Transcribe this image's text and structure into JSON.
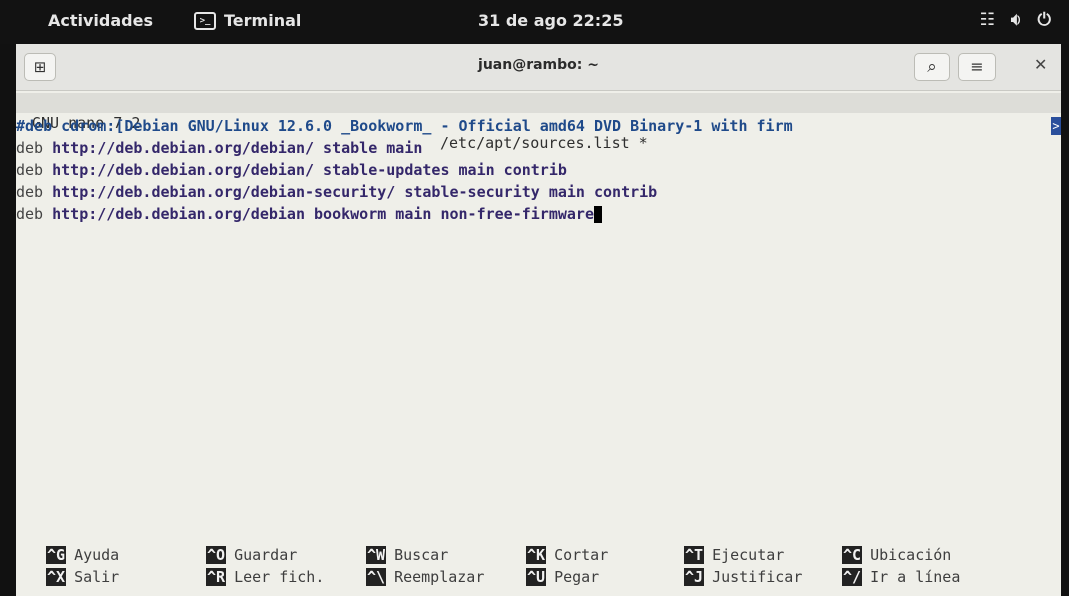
{
  "topbar": {
    "activities": "Actividades",
    "app_name": "Terminal",
    "app_icon": "terminal-icon",
    "clock": "31 de ago  22:25",
    "tray_icons": [
      "network-icon",
      "volume-icon",
      "power-icon"
    ]
  },
  "window": {
    "title": "juan@rambo: ~",
    "new_tab_icon": "new-tab-icon",
    "search_icon": "search-icon",
    "menu_icon": "hamburger-menu-icon",
    "close_icon": "close-icon"
  },
  "nano": {
    "version": "GNU nano 7.2",
    "filename": "/etc/apt/sources.list *",
    "lines": [
      {
        "kw": "#deb",
        "rest": " cdrom:[Debian GNU/Linux 12.6.0 _Bookworm_ - Official amd64 DVD Binary-1 with firm"
      },
      {
        "kw": "deb",
        "rest": " http://deb.debian.org/debian/ stable main"
      },
      {
        "kw": "deb",
        "rest": " http://deb.debian.org/debian/ stable-updates main contrib"
      },
      {
        "kw": "deb",
        "rest": " http://deb.debian.org/debian-security/ stable-security main contrib"
      },
      {
        "kw": "deb",
        "rest": " http://deb.debian.org/debian bookworm main non-free-firmware"
      }
    ],
    "overflow_marker": ">",
    "shortcuts_row1": [
      {
        "key": "^G",
        "label": "Ayuda"
      },
      {
        "key": "^O",
        "label": "Guardar"
      },
      {
        "key": "^W",
        "label": "Buscar"
      },
      {
        "key": "^K",
        "label": "Cortar"
      },
      {
        "key": "^T",
        "label": "Ejecutar"
      },
      {
        "key": "^C",
        "label": "Ubicación"
      }
    ],
    "shortcuts_row2": [
      {
        "key": "^X",
        "label": "Salir"
      },
      {
        "key": "^R",
        "label": "Leer fich."
      },
      {
        "key": "^\\",
        "label": "Reemplazar"
      },
      {
        "key": "^U",
        "label": "Pegar"
      },
      {
        "key": "^J",
        "label": "Justificar"
      },
      {
        "key": "^/",
        "label": "Ir a línea"
      }
    ]
  }
}
